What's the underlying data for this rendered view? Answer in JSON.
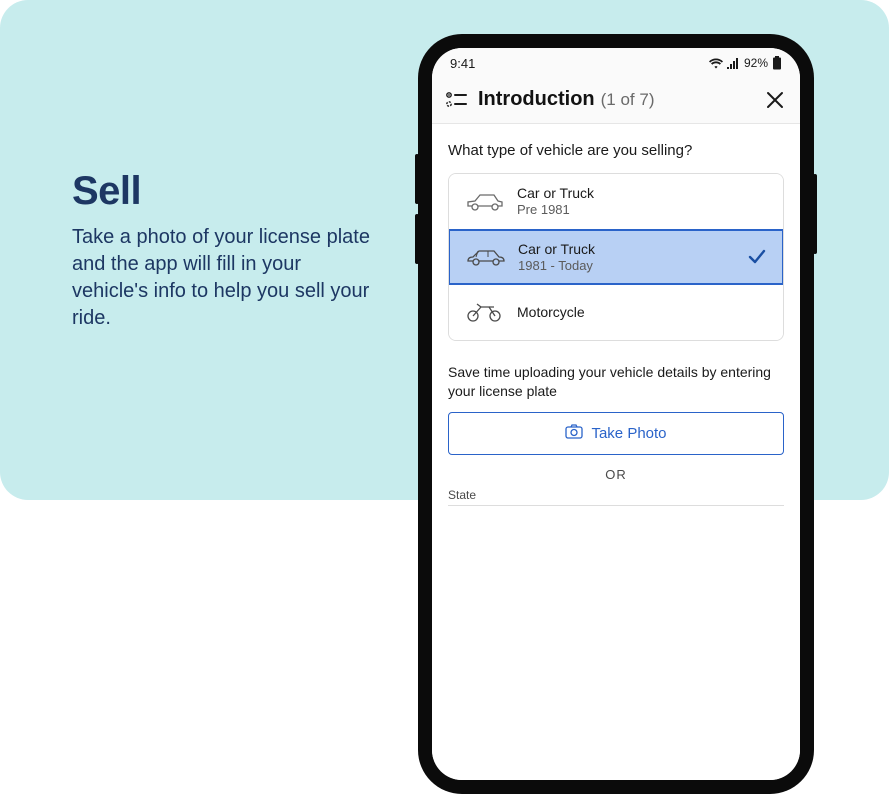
{
  "promo": {
    "headline": "Sell",
    "subtext": "Take a photo of your license plate and the app will fill in your vehicle's info to help you sell your ride."
  },
  "status": {
    "time": "9:41",
    "battery_pct": "92%"
  },
  "screen": {
    "header": {
      "title": "Introduction",
      "step": "(1 of 7)"
    },
    "question": "What type of vehicle are you selling?",
    "options": [
      {
        "title": "Car or Truck",
        "sub": "Pre 1981",
        "selected": false,
        "icon": "car-classic-icon"
      },
      {
        "title": "Car or Truck",
        "sub": "1981 - Today",
        "selected": true,
        "icon": "car-modern-icon"
      },
      {
        "title": "Motorcycle",
        "sub": "",
        "selected": false,
        "icon": "motorcycle-icon"
      }
    ],
    "tip": "Save time uploading your vehicle details by entering your license plate",
    "take_photo_label": "Take Photo",
    "or_label": "OR",
    "state_label": "State"
  }
}
